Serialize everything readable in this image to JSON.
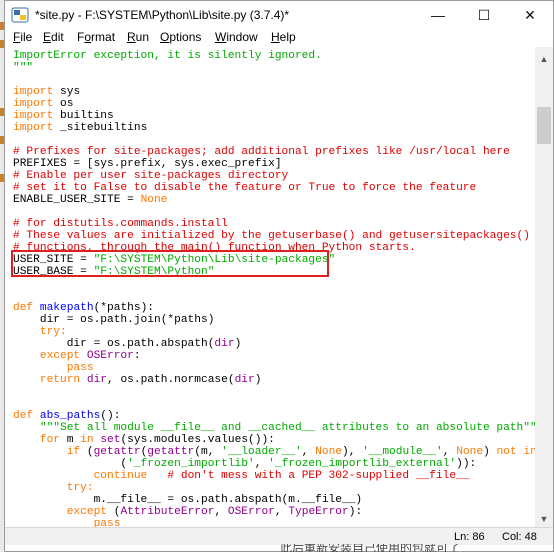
{
  "window": {
    "title": "*site.py - F:\\SYSTEM\\Python\\Lib\\site.py (3.7.4)*",
    "controls": {
      "minimize": "—",
      "maximize": "☐",
      "close": "✕"
    }
  },
  "menu": [
    {
      "label": "File",
      "mnemonic": "F"
    },
    {
      "label": "Edit",
      "mnemonic": "E"
    },
    {
      "label": "Format",
      "mnemonic": "o"
    },
    {
      "label": "Run",
      "mnemonic": "R"
    },
    {
      "label": "Options",
      "mnemonic": "O"
    },
    {
      "label": "Window",
      "mnemonic": "W"
    },
    {
      "label": "Help",
      "mnemonic": "H"
    }
  ],
  "code": {
    "l01": "ImportError exception, it is silently ignored.",
    "l02": "\"\"\"",
    "l03_kw": "import",
    "l03_rest": " sys",
    "l04_kw": "import",
    "l04_rest": " os",
    "l05_kw": "import",
    "l05_rest": " builtins",
    "l06_kw": "import",
    "l06_rest": " _sitebuiltins",
    "l07": "# Prefixes for site-packages; add additional prefixes like /usr/local here",
    "l08": "PREFIXES = [sys.prefix, sys.exec_prefix]",
    "l09": "# Enable per user site-packages directory",
    "l10": "# set it to False to disable the feature or True to force the feature",
    "l11_a": "ENABLE_USER_SITE = ",
    "l11_b": "None",
    "l12": "# for distutils.commands.install",
    "l13": "# These values are initialized by the getuserbase() and getusersitepackages()",
    "l14": "# functions, through the main() function when Python starts.",
    "l15_a": "USER_SITE = ",
    "l15_b": "\"F:\\SYSTEM\\Python\\Lib\\site-packages\"",
    "l16_a": "USER_BASE = ",
    "l16_b": "\"F:\\SYSTEM\\Python\"",
    "l17_kw": "def",
    "l17_fn": " makepath",
    "l17_rest": "(*paths):",
    "l18": "    dir = os.path.join(*paths)",
    "l19_kw": "    try:",
    "l20_a": "        dir = os.path.abspath(",
    "l20_b": "dir",
    "l20_c": ")",
    "l21_kw": "    except",
    "l21_bi": " OSError",
    "l21_rest": ":",
    "l22_kw": "        pass",
    "l23_kw": "    return",
    "l23_a": " ",
    "l23_b": "dir",
    "l23_c": ", os.path.normcase(",
    "l23_d": "dir",
    "l23_e": ")",
    "l24_kw": "def",
    "l24_fn": " abs_paths",
    "l24_rest": "():",
    "l25": "    \"\"\"Set all module __file__ and __cached__ attributes to an absolute path\"\"\"",
    "l26_kw": "    for",
    "l26_a": " m ",
    "l26_kw2": "in",
    "l26_b": " ",
    "l26_bi": "set",
    "l26_c": "(sys.modules.values()):",
    "l27_kw": "        if",
    "l27_a": " (",
    "l27_bi": "getattr",
    "l27_b": "(",
    "l27_bi2": "getattr",
    "l27_c": "(m, ",
    "l27_s1": "'__loader__'",
    "l27_d": ", ",
    "l27_n1": "None",
    "l27_e": "), ",
    "l27_s2": "'__module__'",
    "l27_f": ", ",
    "l27_n2": "None",
    "l27_g": ") ",
    "l27_kw2": "not in",
    "l28_a": "                (",
    "l28_s1": "'_frozen_importlib'",
    "l28_b": ", ",
    "l28_s2": "'_frozen_importlib_external'",
    "l28_c": ")):",
    "l29_kw": "            continue",
    "l29_cm": "   # don't mess with a PEP 302-supplied __file__",
    "l30_kw": "        try:",
    "l31": "            m.__file__ = os.path.abspath(m.__file__)",
    "l32_kw": "        except",
    "l32_a": " (",
    "l32_bi1": "AttributeError",
    "l32_b": ", ",
    "l32_bi2": "OSError",
    "l32_c": ", ",
    "l32_bi3": "TypeError",
    "l32_d": "):",
    "l33_kw": "            pass"
  },
  "status": {
    "line": "Ln: 86",
    "col": "Col: 48"
  },
  "background_snippet": "此后重新安装自己使用的包就可了",
  "colors": {
    "keyword": "#ff7700",
    "builtin": "#900090",
    "string": "#00aa00",
    "comment": "#dd0000",
    "definition": "#0000ff",
    "highlight": "#e02020"
  },
  "icons": {
    "app": "python-idle-icon",
    "scroll_up": "triangle-up-icon",
    "scroll_down": "triangle-down-icon"
  }
}
